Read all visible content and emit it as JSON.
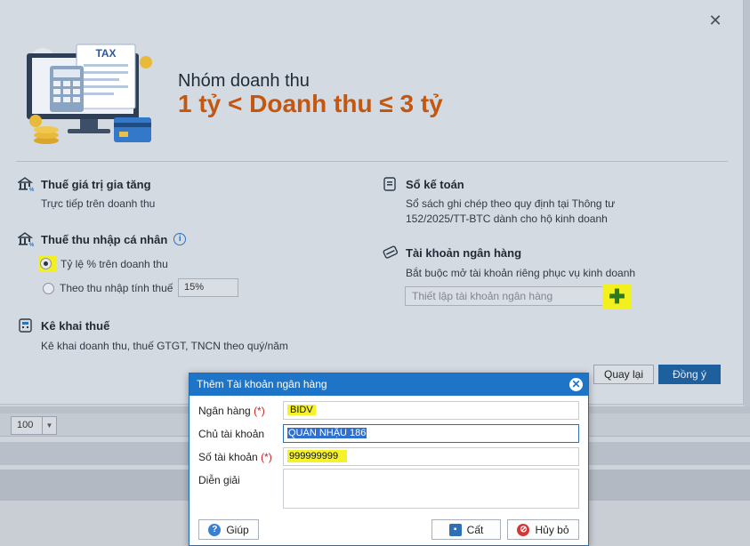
{
  "background": {
    "page_size": "100"
  },
  "revenue_dialog": {
    "group_label": "Nhóm doanh thu",
    "group_value": "1 tỷ < Doanh thu ≤ 3 tỷ",
    "illustration_text": "TAX",
    "vat": {
      "title": "Thuế giá trị gia tăng",
      "desc": "Trực tiếp trên doanh thu"
    },
    "pit": {
      "title": "Thuế thu nhập cá nhân",
      "option1": "Tỷ lệ % trên doanh thu",
      "option2": "Theo thu nhập tính thuế",
      "rate": "15%"
    },
    "declaration": {
      "title": "Kê khai thuế",
      "desc": "Kê khai doanh thu, thuế GTGT, TNCN theo quý/năm"
    },
    "ledger": {
      "title": "Sổ kế toán",
      "desc_line1": "Sổ sách ghi chép theo quy định tại Thông tư",
      "desc_line2": "152/2025/TT-BTC dành cho hộ kinh doanh"
    },
    "bank": {
      "title": "Tài khoản ngân hàng",
      "desc": "Bắt buộc mở tài khoản riêng phục vụ kinh doanh",
      "placeholder": "Thiết lập tài khoản ngân hàng"
    },
    "back_label": "Quay lại",
    "ok_label": "Đồng ý"
  },
  "bank_dialog": {
    "title": "Thêm Tài khoản ngân hàng",
    "bank_label": "Ngân hàng",
    "bank_value": "BIDV",
    "holder_label": "Chủ tài khoản",
    "holder_value": "QUÁN NHẬU 186",
    "number_label": "Số tài khoản",
    "number_value": "999999999",
    "note_label": "Diễn giải",
    "required_mark": "(*)",
    "help_label": "Giúp",
    "save_label": "Cất",
    "cancel_label": "Hủy bỏ"
  }
}
